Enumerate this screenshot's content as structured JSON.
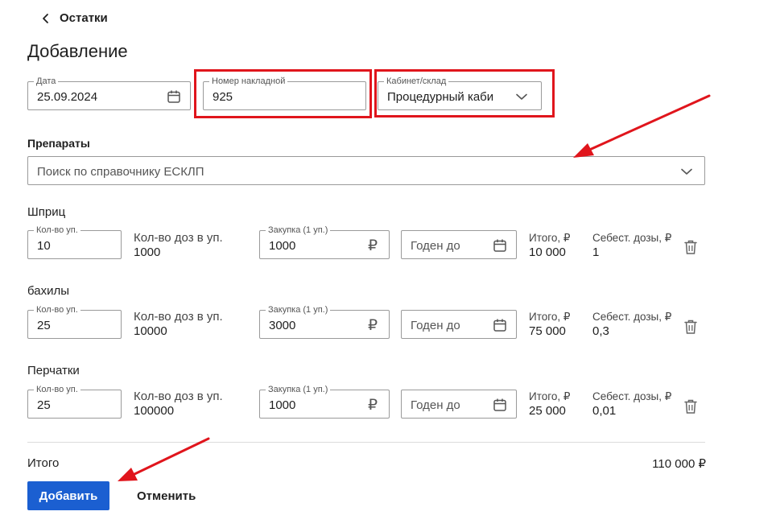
{
  "header": {
    "back_label": "Остатки",
    "title": "Добавление"
  },
  "form": {
    "date": {
      "label": "Дата",
      "value": "25.09.2024"
    },
    "invoice": {
      "label": "Номер накладной",
      "value": "925"
    },
    "cabinet": {
      "label": "Кабинет/склад",
      "value": "Процедурный каби"
    }
  },
  "drugs": {
    "section_label": "Препараты",
    "search_placeholder": "Поиск по справочнику ЕСКЛП"
  },
  "labels": {
    "qty_per_pack": "Кол-во уп.",
    "doses_per_pack": "Кол-во доз в уп.",
    "purchase": "Закупка (1 уп.)",
    "expires": "Годен до",
    "total": "Итого, ₽",
    "dose_cost": "Себест. дозы, ₽",
    "currency": "₽"
  },
  "items": [
    {
      "name": "Шприц",
      "qty": "10",
      "doses": "1000",
      "purchase": "1000",
      "total": "10 000",
      "dose_cost": "1"
    },
    {
      "name": "бахилы",
      "qty": "25",
      "doses": "10000",
      "purchase": "3000",
      "total": "75 000",
      "dose_cost": "0,3"
    },
    {
      "name": "Перчатки",
      "qty": "25",
      "doses": "100000",
      "purchase": "1000",
      "total": "25 000",
      "dose_cost": "0,01"
    }
  ],
  "summary": {
    "label": "Итого",
    "value": "110 000 ₽"
  },
  "actions": {
    "add_label": "Добавить",
    "cancel_label": "Отменить"
  },
  "colors": {
    "primary": "#1b5fd1",
    "annotation": "#e0151c"
  },
  "icons": {
    "back": "chevron-left-icon",
    "calendar": "calendar-icon",
    "dropdown": "chevron-down-icon",
    "delete": "trash-icon"
  }
}
